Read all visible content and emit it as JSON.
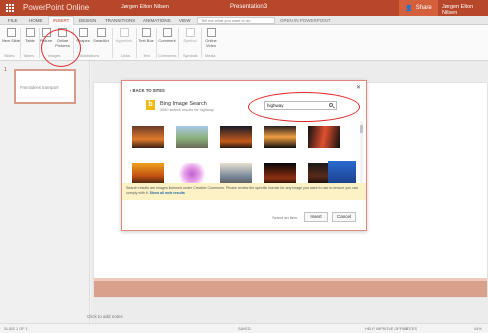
{
  "titlebar": {
    "app_name": "PowerPoint Online",
    "author": "Jørgen Elton Nilsen",
    "doc_title": "Presentation3",
    "share_label": "Share",
    "user_name": "Jørgen Elton Nilsen",
    "accent": "#b7472a"
  },
  "tabs": [
    {
      "label": "FILE"
    },
    {
      "label": "HOME"
    },
    {
      "label": "INSERT"
    },
    {
      "label": "DESIGN"
    },
    {
      "label": "TRANSITIONS"
    },
    {
      "label": "ANIMATIONS"
    },
    {
      "label": "VIEW"
    }
  ],
  "tell_me_placeholder": "Tell me what you want to do",
  "open_in_label": "OPEN IN POWERPOINT",
  "ribbon": {
    "buttons": [
      {
        "label": "New Slide",
        "icon": "new-slide-icon"
      },
      {
        "label": "Table",
        "icon": "table-icon"
      },
      {
        "label": "Picture",
        "icon": "picture-icon"
      },
      {
        "label": "Online Pictures",
        "icon": "online-pictures-icon"
      },
      {
        "label": "Shapes",
        "icon": "shapes-icon"
      },
      {
        "label": "SmartArt",
        "icon": "smartart-icon"
      },
      {
        "label": "Hyperlink",
        "icon": "hyperlink-icon"
      },
      {
        "label": "Text Box",
        "icon": "textbox-icon"
      },
      {
        "label": "Comment",
        "icon": "comment-icon"
      },
      {
        "label": "Symbol",
        "icon": "symbol-icon"
      },
      {
        "label": "Online Video",
        "icon": "online-video-icon"
      }
    ],
    "groups": [
      "Slides",
      "Tables",
      "Images",
      "Illustrations",
      "Links",
      "Text",
      "Comments",
      "Symbols",
      "Media"
    ]
  },
  "thumbs": {
    "number": "1",
    "text": "Fremtidens transport"
  },
  "slide": {
    "title_visible": "port"
  },
  "notes_placeholder": "Click to add notes",
  "dialog": {
    "back_label": "‹ BACK TO SITES",
    "source_title": "Bing Image Search",
    "results_summary": "3980 search results for highway",
    "search_value": "highway",
    "license_text": "Search results are images licensed under Creative Commons. Please review the specific license for any image you want to use to ensure you can comply with it.",
    "license_link": "Show all web results",
    "selected_label": "Select an item",
    "insert_label": "Insert",
    "cancel_label": "Cancel",
    "close_icon": "close-icon"
  },
  "status": {
    "slide_info": "SLIDE 1 OF 1",
    "saved": "SAVED",
    "help": "HELP IMPROVE OFFICE",
    "notes": "NOTES",
    "zoom": "44%"
  }
}
